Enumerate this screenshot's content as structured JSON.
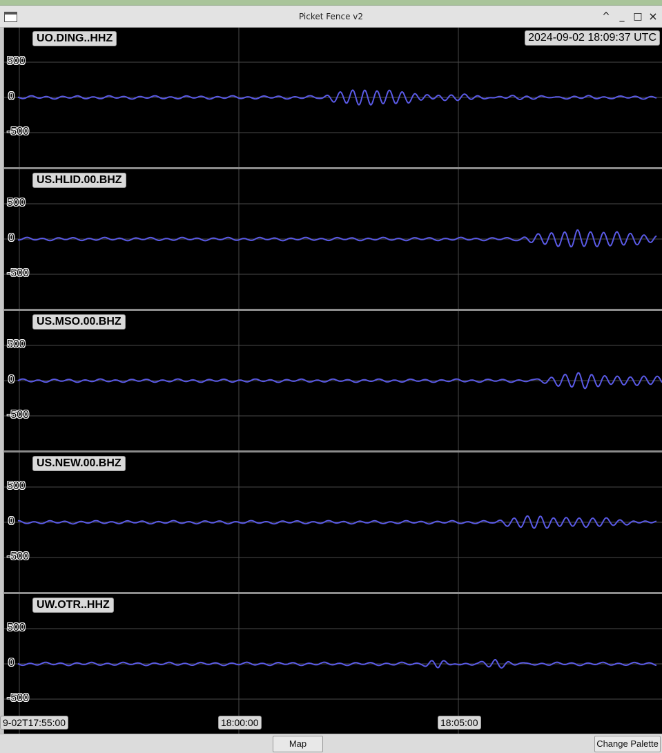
{
  "window": {
    "title": "Picket Fence v2",
    "controls": [
      "^",
      "_",
      "□",
      "×"
    ]
  },
  "timestamp": "2024-09-02 18:09:37 UTC",
  "y_ticks": [
    "500",
    "0",
    "-500"
  ],
  "x_ticks": [
    "9-02T17:55:00",
    "18:00:00",
    "18:05:00"
  ],
  "trace_color": "#5a5ae6",
  "stations": [
    {
      "name": "UO.DING..HHZ"
    },
    {
      "name": "US.HLID.00.BHZ"
    },
    {
      "name": "US.MSO.00.BHZ"
    },
    {
      "name": "US.NEW.00.BHZ"
    },
    {
      "name": "UW.OTR..HHZ"
    }
  ],
  "buttons": {
    "map": "Map",
    "change_palette": "Change Palette"
  }
}
